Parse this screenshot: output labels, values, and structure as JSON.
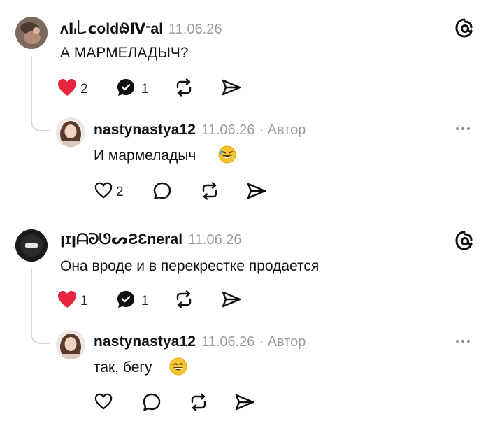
{
  "colors": {
    "like": "#e8253f",
    "accent": "#111111",
    "muted": "#9b9b9b",
    "divider": "#e6e6e6"
  },
  "threads": [
    {
      "comment": {
        "username": "ᴧⅠ៲꒒ⅽoldᱷⅣᱼal",
        "date": "11.06.26",
        "text": "А МАРМЕЛАДЫЧ?",
        "likes": "2",
        "replies": "1",
        "liked": true,
        "app_icon": "threads-icon"
      },
      "reply": {
        "username": "nastynastya12",
        "date": "11.06.26",
        "author_tag": "· Автор",
        "text": "И мармеладыч",
        "emoji": "rofl-emoji",
        "likes": "2"
      }
    },
    {
      "comment": {
        "username": "ꞁɪꞁᗩᘒᘎᔕƧƐneral",
        "date": "11.06.26",
        "text": "Она вроде и в перекрестке продается",
        "likes": "1",
        "replies": "1",
        "liked": true,
        "app_icon": "threads-icon"
      },
      "reply": {
        "username": "nastynastya12",
        "date": "11.06.26",
        "author_tag": "· Автор",
        "text": "так, бегу",
        "emoji": "grin-emoji",
        "likes": ""
      }
    }
  ]
}
